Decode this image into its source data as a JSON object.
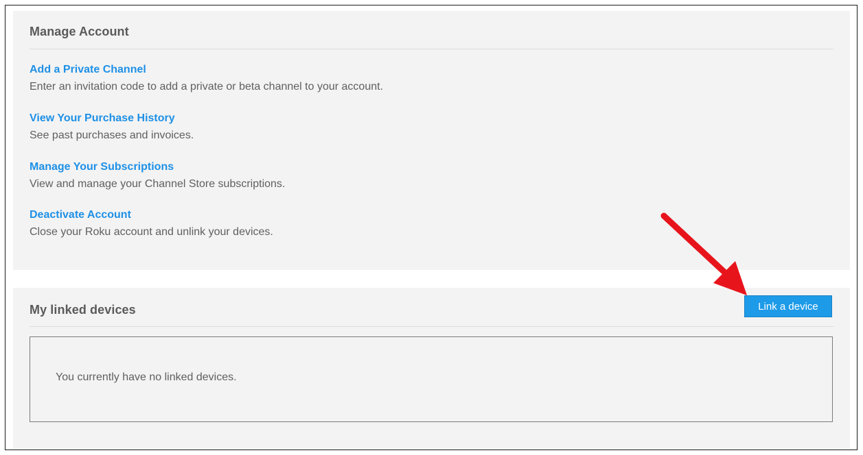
{
  "manage_account": {
    "title": "Manage Account",
    "items": [
      {
        "link": "Add a Private Channel",
        "description": "Enter an invitation code to add a private or beta channel to your account."
      },
      {
        "link": "View Your Purchase History",
        "description": "See past purchases and invoices."
      },
      {
        "link": "Manage Your Subscriptions",
        "description": "View and manage your Channel Store subscriptions."
      },
      {
        "link": "Deactivate Account",
        "description": "Close your Roku account and unlink your devices."
      }
    ]
  },
  "linked_devices": {
    "title": "My linked devices",
    "link_button_label": "Link a device",
    "empty_message": "You currently have no linked devices."
  },
  "colors": {
    "link": "#1e90e6",
    "button": "#1e9be8",
    "panel_background": "#f3f3f3",
    "annotation_arrow": "#e8141c"
  },
  "icons": {
    "annotation": "red-arrow-icon"
  }
}
